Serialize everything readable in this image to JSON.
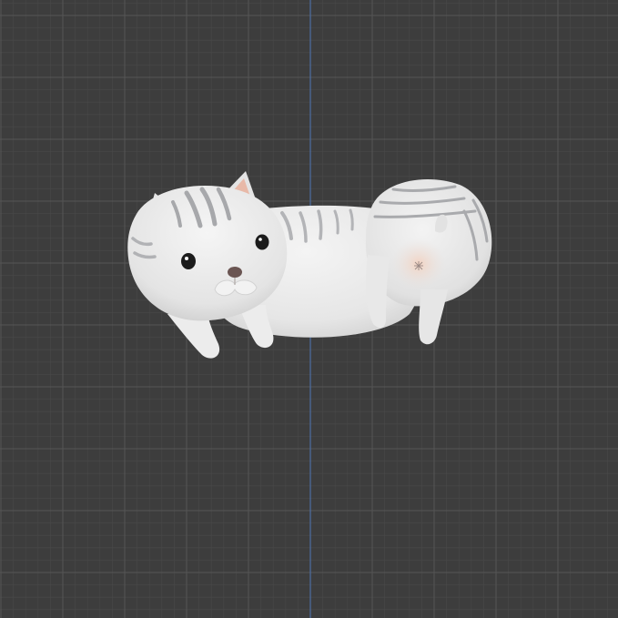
{
  "viewport": {
    "background_color": "#3d3d3d",
    "minor_grid_color": "#474747",
    "major_grid_color": "#555555",
    "axis_color": "#4d6ea3"
  },
  "scene": {
    "object": "cat-donut-model",
    "colors": {
      "body": "#ececec",
      "body_shade": "#d4d4d4",
      "stripe": "#a9aaad",
      "ear_inner": "#e8b9a8",
      "nose": "#6a5552",
      "eye": "#1c1c1c",
      "paw_pad": "#f1d5c7"
    }
  }
}
